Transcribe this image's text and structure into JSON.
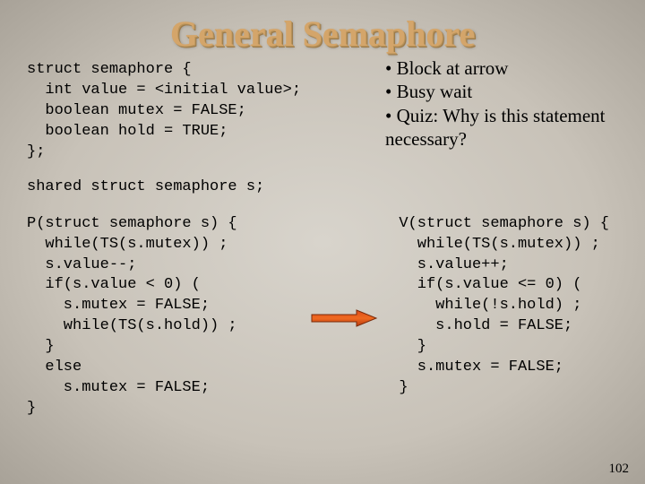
{
  "title": "General Semaphore",
  "struct_code": "struct semaphore {\n  int value = <initial value>;\n  boolean mutex = FALSE;\n  boolean hold = TRUE;\n};",
  "bullets": {
    "b1": "• Block at arrow",
    "b2": "• Busy wait",
    "b3": "• Quiz: Why is this statement necessary?"
  },
  "shared_line": "shared struct semaphore s;",
  "p_code": "P(struct semaphore s) {\n  while(TS(s.mutex)) ;\n  s.value--;\n  if(s.value < 0) (\n    s.mutex = FALSE;\n    while(TS(s.hold)) ;\n  }\n  else\n    s.mutex = FALSE;\n}",
  "v_code": "V(struct semaphore s) {\n  while(TS(s.mutex)) ;\n  s.value++;\n  if(s.value <= 0) (\n    while(!s.hold) ;\n    s.hold = FALSE;\n  }\n  s.mutex = FALSE;\n}",
  "page_number": "102"
}
